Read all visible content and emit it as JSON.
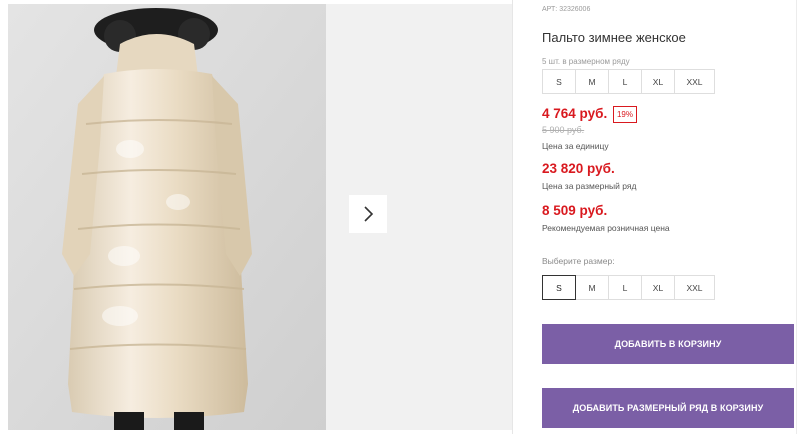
{
  "product": {
    "article": "АРТ: 32326006",
    "title": "Пальто зимнее женское",
    "pack_label": "5 шт. в размерном ряду",
    "pack_sizes": [
      "S",
      "M",
      "L",
      "XL",
      "XXL"
    ],
    "price": "4 764 руб.",
    "discount": "19%",
    "old_price": "5 900 руб.",
    "price_unit_label": "Цена за единицу",
    "pack_price": "23 820 руб.",
    "pack_price_label": "Цена за размерный ряд",
    "retail_price": "8 509 руб.",
    "retail_price_label": "Рекомендуемая розничная цена",
    "choose_size_label": "Выберите размер:",
    "select_sizes": [
      "S",
      "M",
      "L",
      "XL",
      "XXL"
    ],
    "selected_size": "S",
    "add_to_cart_label": "ДОБАВИТЬ В КОРЗИНУ",
    "add_pack_label": "ДОБАВИТЬ РАЗМЕРНЫЙ РЯД В КОРЗИНУ"
  },
  "gallery": {
    "next_icon": "chevron-right-icon",
    "image_subject": "coat-photo"
  },
  "colors": {
    "price_red": "#d9191f",
    "button_purple": "#7b5fa6",
    "coat_cream": "#efe4d0"
  }
}
